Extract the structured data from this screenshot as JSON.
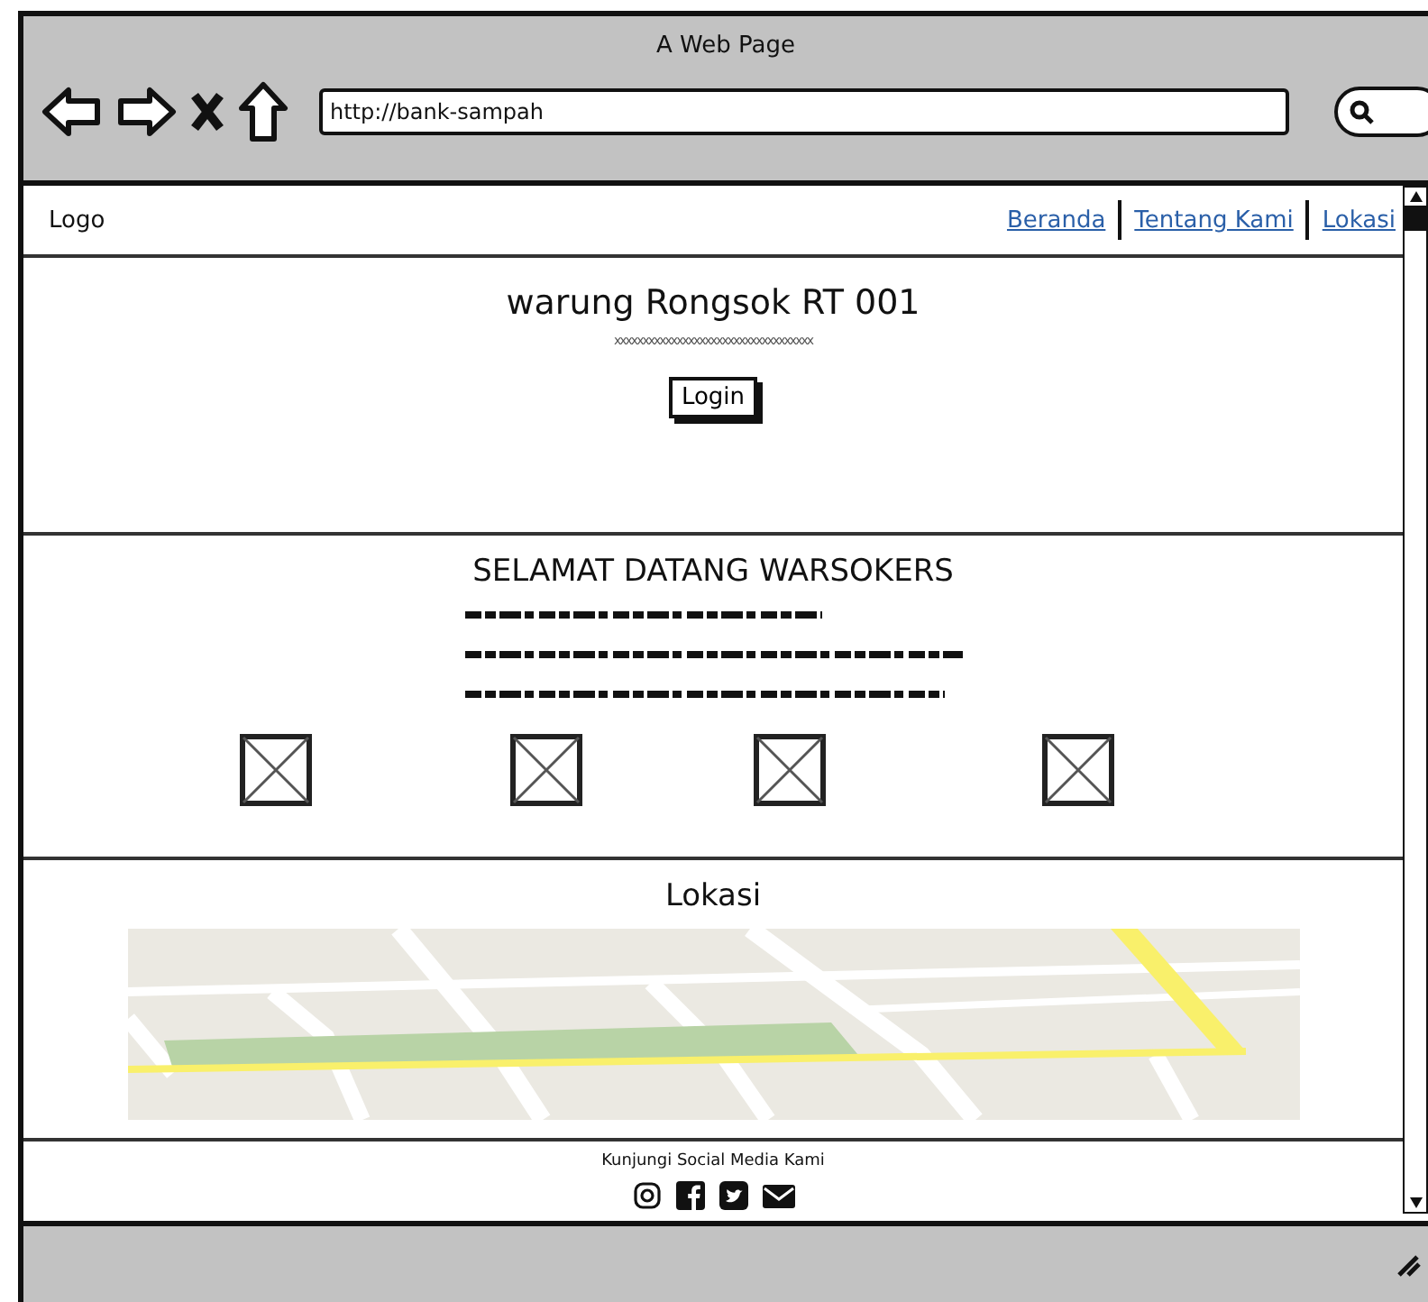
{
  "window": {
    "title": "A Web Page"
  },
  "toolbar": {
    "address": "http://bank-sampah"
  },
  "nav": {
    "logo": "Logo",
    "links": [
      "Beranda",
      "Tentang Kami",
      "Lokasi"
    ]
  },
  "hero": {
    "title": "warung Rongsok RT 001",
    "subtitle": "xxxxxxxxxxxxxxxxxxxxxxxxxxxxxxxxxxx",
    "button": "Login"
  },
  "welcome": {
    "title": "SELAMAT DATANG WARSOKERS"
  },
  "location": {
    "title": "Lokasi"
  },
  "footer": {
    "text": "Kunjungi Social Media Kami"
  }
}
